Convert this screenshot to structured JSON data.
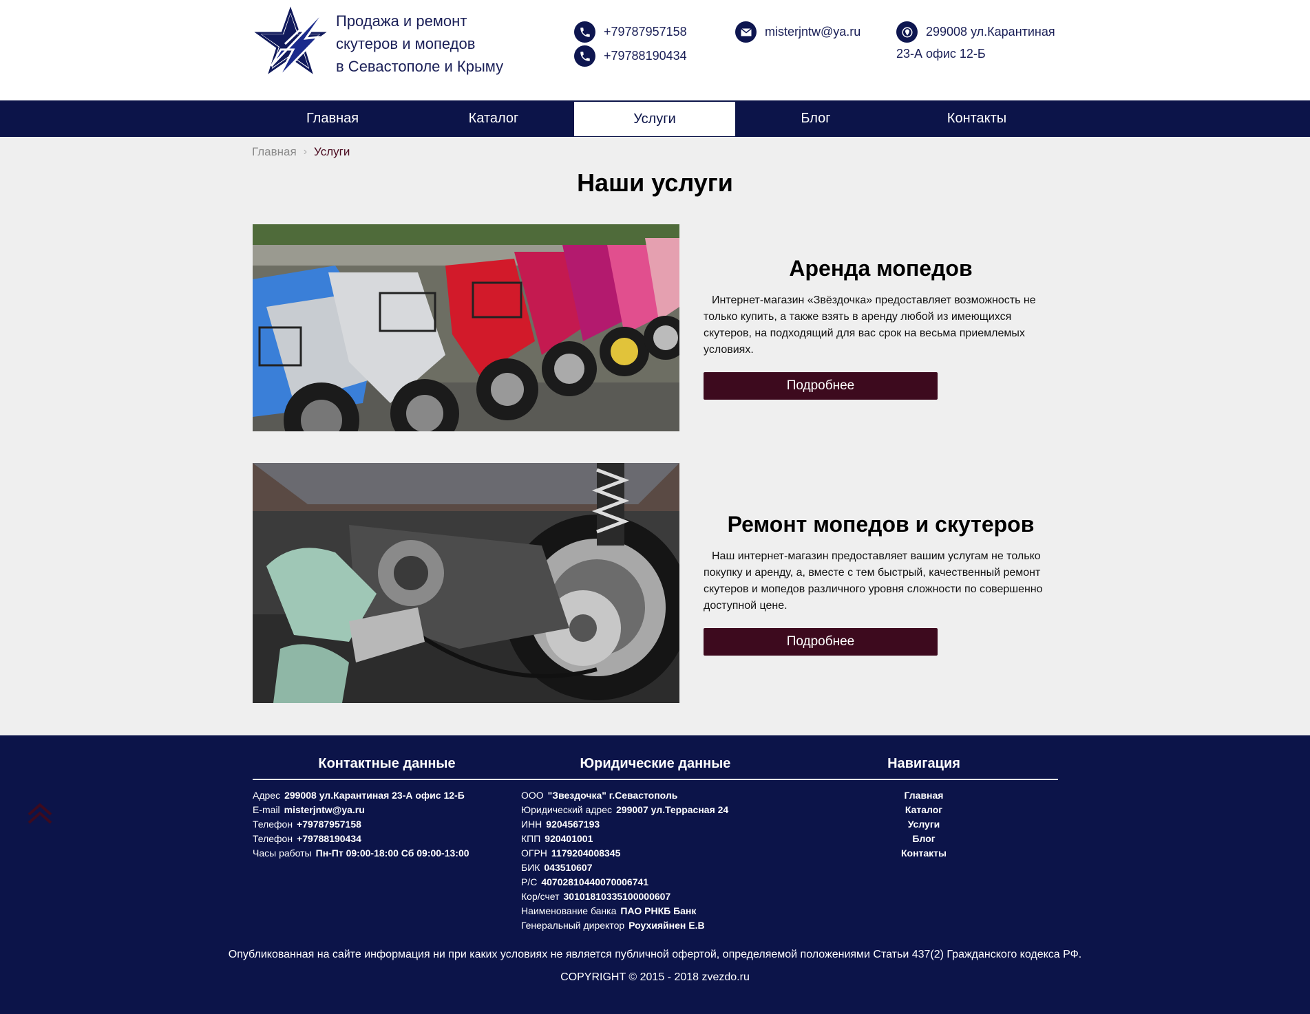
{
  "header": {
    "tagline": [
      "Продажа и ремонт",
      "скутеров и мопедов",
      "в Севастополе и Крыму"
    ],
    "phone1": "+79787957158",
    "phone2": "+79788190434",
    "email": "misterjntw@ya.ru",
    "address_line1": "299008 ул.Карантиная",
    "address_line2": "23-А офис 12-Б"
  },
  "nav": {
    "items": [
      "Главная",
      "Каталог",
      "Услуги",
      "Блог",
      "Контакты"
    ],
    "active": "Услуги"
  },
  "breadcrumb": {
    "home": "Главная",
    "separator": "›",
    "current": "Услуги"
  },
  "page_title": "Наши услуги",
  "services": [
    {
      "title": "Аренда мопедов",
      "description": "Интернет-магазин «Звёздочка» предоставляет возможность не только купить, а также взять в аренду любой из имеющихся скутеров, на подходящий для вас срок на весьма приемлемых условиях.",
      "button": "Подробнее"
    },
    {
      "title": "Ремонт мопедов и скутеров",
      "description": "Наш интернет-магазин предоставляет вашим услугам не только покупку и аренду, а, вместе с тем быстрый, качественный ремонт скутеров и мопедов различного уровня сложности по совершенно доступной цене.",
      "button": "Подробнее"
    }
  ],
  "footer": {
    "contacts": {
      "title": "Контактные данные",
      "rows": [
        {
          "label": "Адрес",
          "value": "299008 ул.Карантиная 23-А офис 12-Б"
        },
        {
          "label": "E-mail",
          "value": "misterjntw@ya.ru"
        },
        {
          "label": "Телефон",
          "value": "+79787957158"
        },
        {
          "label": "Телефон",
          "value": "+79788190434"
        },
        {
          "label": "Часы работы",
          "value": "Пн-Пт 09:00-18:00 Сб 09:00-13:00"
        }
      ]
    },
    "legal": {
      "title": "Юридические данные",
      "rows": [
        {
          "label": "ООО",
          "value": "\"Звездочка\" г.Севастополь"
        },
        {
          "label": "Юридический адрес",
          "value": "299007 ул.Террасная 24"
        },
        {
          "label": "ИНН",
          "value": "9204567193"
        },
        {
          "label": "КПП",
          "value": "920401001"
        },
        {
          "label": "ОГРН",
          "value": "1179204008345"
        },
        {
          "label": "БИК",
          "value": "043510607"
        },
        {
          "label": "Р/С",
          "value": "40702810440070006741"
        },
        {
          "label": "Кор/счет",
          "value": "30101810335100000607"
        },
        {
          "label": "Наименование банка",
          "value": "ПАО РНКБ Банк"
        },
        {
          "label": "Генеральный директор",
          "value": "Роухияйнен Е.В"
        }
      ]
    },
    "navigation": {
      "title": "Навигация",
      "links": [
        "Главная",
        "Каталог",
        "Услуги",
        "Блог",
        "Контакты"
      ]
    },
    "disclaimer": "Опубликованная на сайте информация ни при каких условиях не является публичной офертой, определяемой положениями Статьи 437(2) Гражданского кодекса РФ.",
    "copyright": "COPYRIGHT © 2015 - 2018 zvezdo.ru"
  },
  "colors": {
    "navy": "#0c1449",
    "button": "#3d0a1e",
    "background": "#efefef",
    "text_header": "#1a1f57"
  },
  "icons": [
    "star-logo-icon",
    "phone-icon",
    "mail-icon",
    "location-icon",
    "scroll-top-icon"
  ]
}
